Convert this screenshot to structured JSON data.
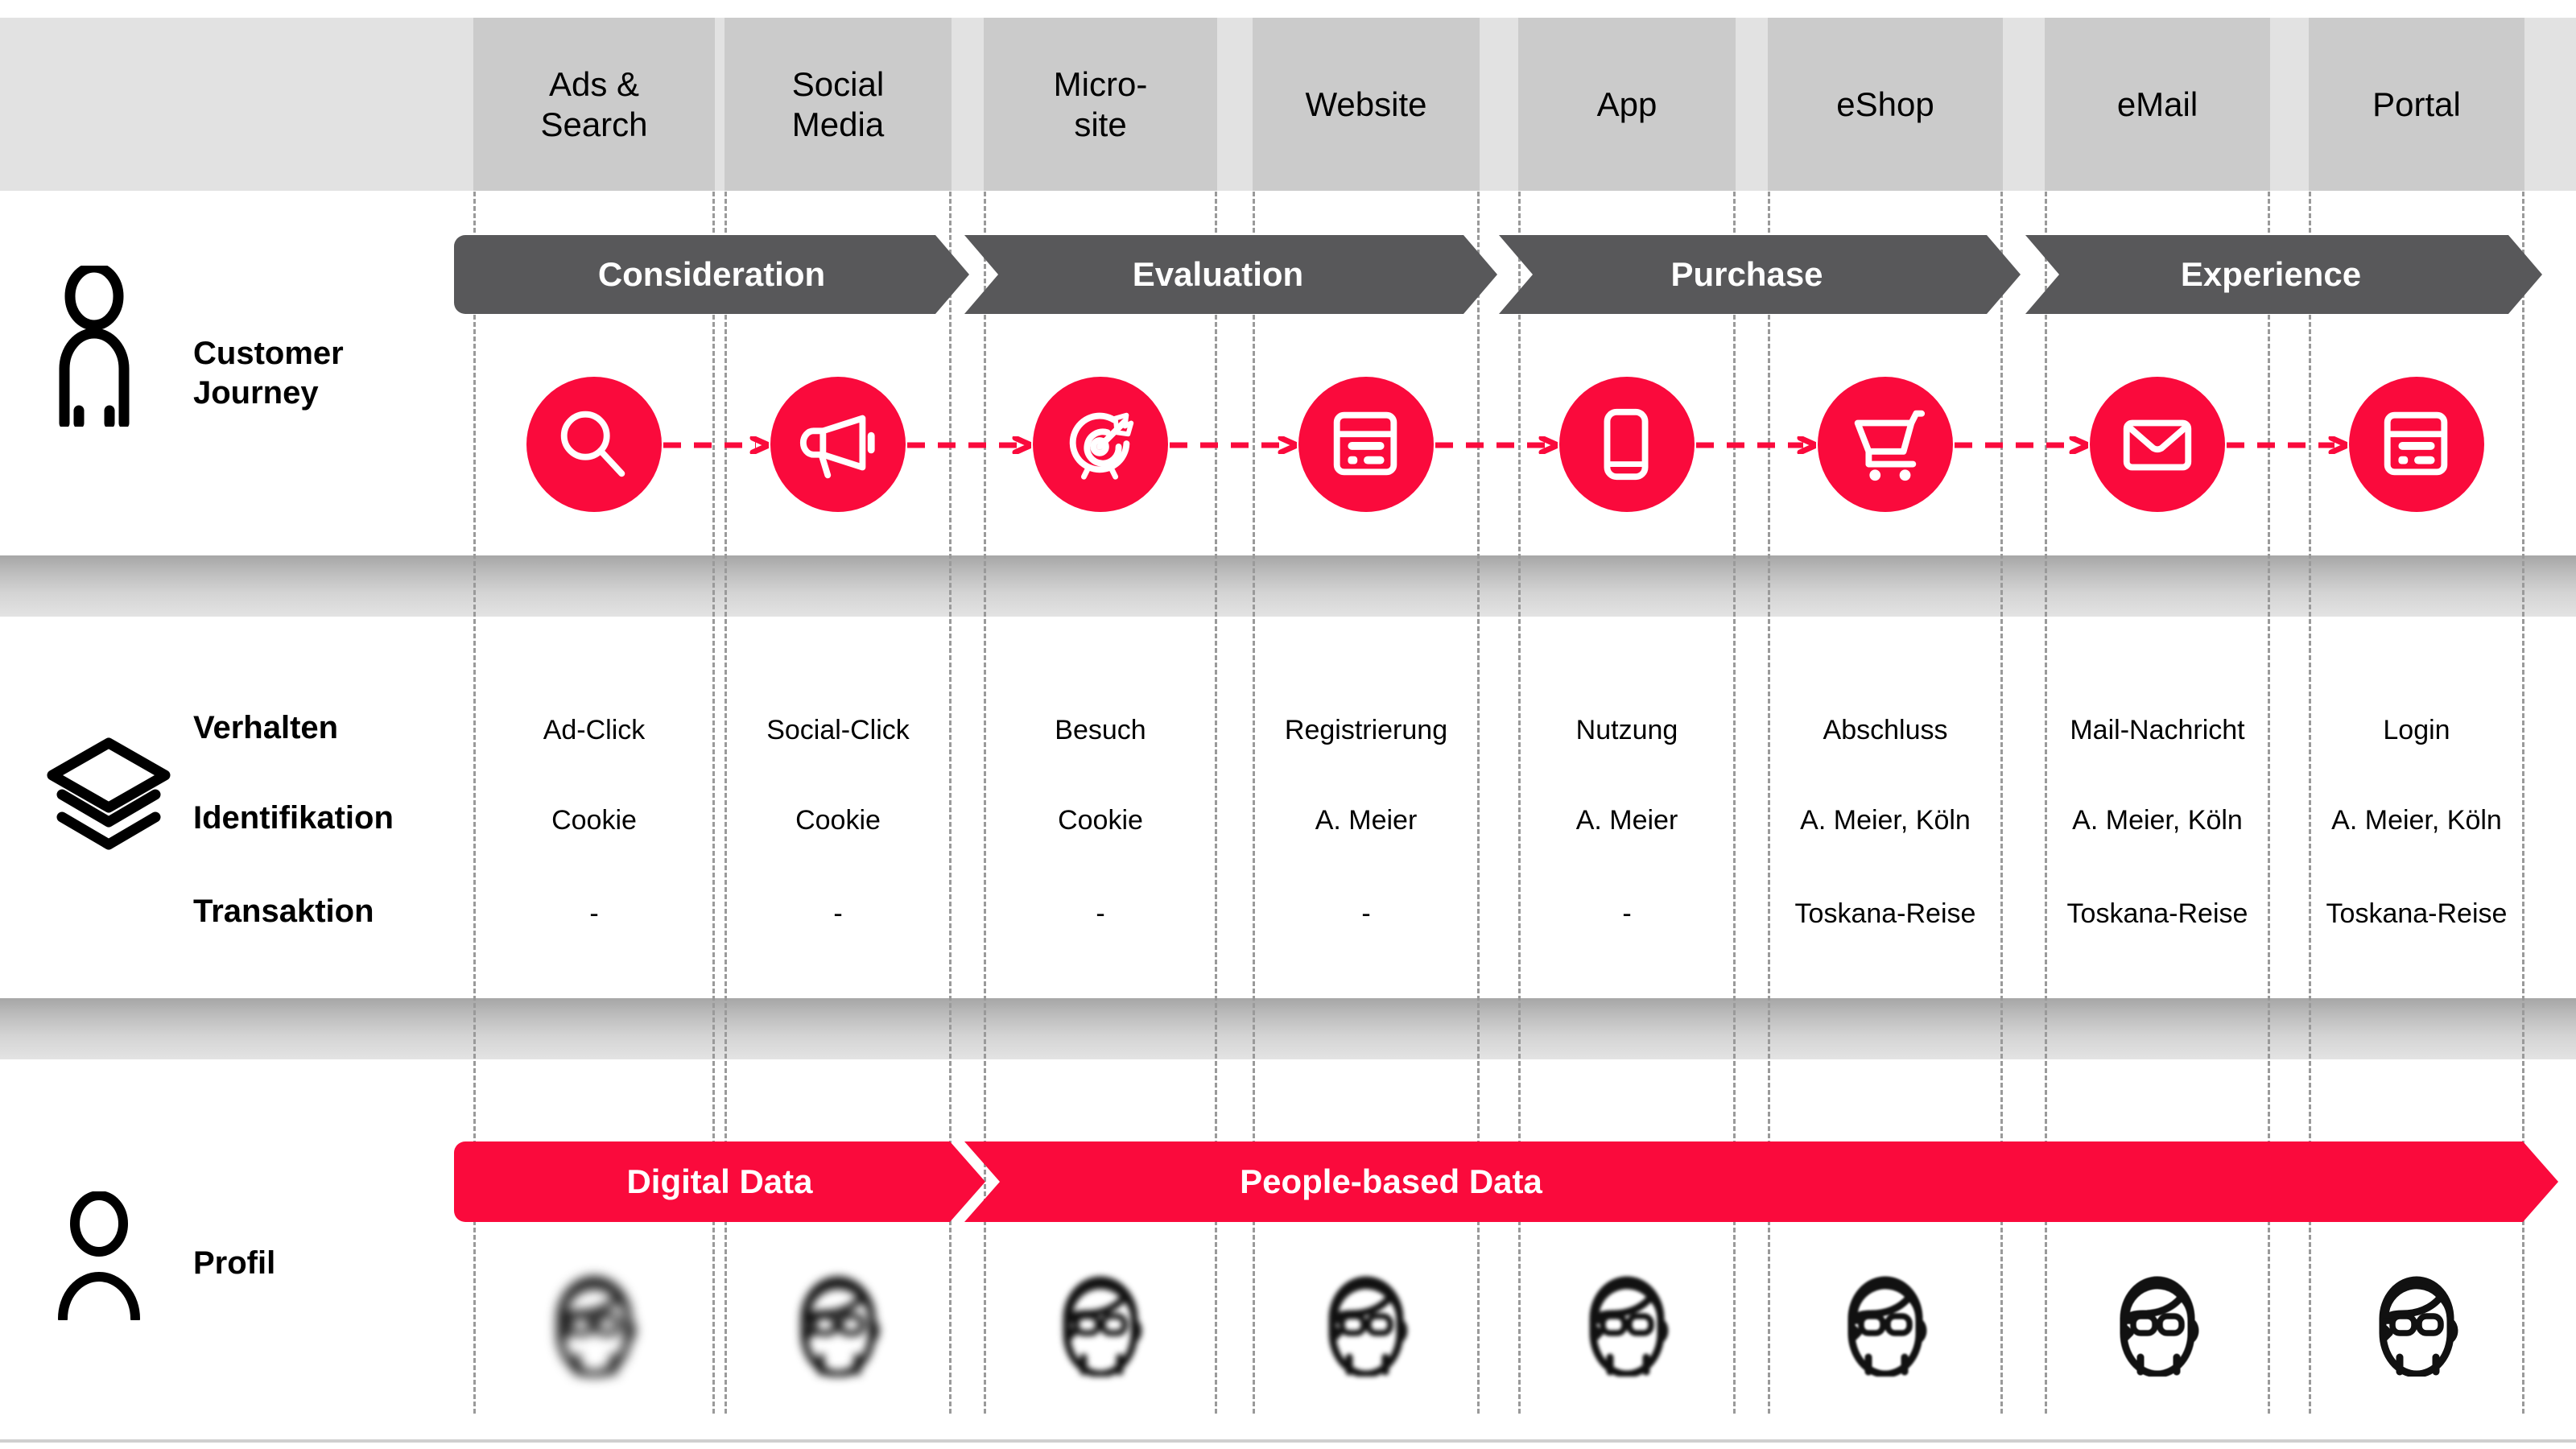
{
  "colors": {
    "accent_red": "#fa0a3c",
    "stage_dark": "#58585a",
    "header_band": "#e2e2e2",
    "channel_box": "#cbcbcb",
    "dashed_lane": "#9a9a9a"
  },
  "channels": [
    {
      "label": "Ads & Search",
      "line1": "Ads &",
      "line2": "Search"
    },
    {
      "label": "Social Media",
      "line1": "Social",
      "line2": "Media"
    },
    {
      "label": "Micro-site",
      "line1": "Micro-",
      "line2": "site"
    },
    {
      "label": "Website",
      "line1": "Website",
      "line2": ""
    },
    {
      "label": "App",
      "line1": "App",
      "line2": ""
    },
    {
      "label": "eShop",
      "line1": "eShop",
      "line2": ""
    },
    {
      "label": "eMail",
      "line1": "eMail",
      "line2": ""
    },
    {
      "label": "Portal",
      "line1": "Portal",
      "line2": ""
    }
  ],
  "rows": {
    "journey": {
      "label_line1": "Customer",
      "label_line2": "Journey",
      "icon": "person-standing-icon"
    },
    "data": {
      "icon": "layers-stack-icon"
    },
    "profile": {
      "label": "Profil",
      "icon": "person-bust-icon"
    }
  },
  "journey_stages": [
    {
      "label": "Consideration"
    },
    {
      "label": "Evaluation"
    },
    {
      "label": "Purchase"
    },
    {
      "label": "Experience"
    }
  ],
  "journey_touchpoints": [
    {
      "channel": "Ads & Search",
      "icon": "magnifier-search-icon"
    },
    {
      "channel": "Social Media",
      "icon": "megaphone-icon"
    },
    {
      "channel": "Micro-site",
      "icon": "target-dartboard-icon"
    },
    {
      "channel": "Website",
      "icon": "webpage-browser-icon"
    },
    {
      "channel": "App",
      "icon": "mobile-phone-icon"
    },
    {
      "channel": "eShop",
      "icon": "shopping-cart-icon"
    },
    {
      "channel": "eMail",
      "icon": "envelope-mail-icon"
    },
    {
      "channel": "Portal",
      "icon": "webpage-browser-icon"
    }
  ],
  "data_table": {
    "row_headers": [
      "Verhalten",
      "Identifikation",
      "Transaktion"
    ],
    "columns": [
      "Ads & Search",
      "Social Media",
      "Micro-site",
      "Website",
      "App",
      "eShop",
      "eMail",
      "Portal"
    ],
    "values": [
      [
        "Ad-Click",
        "Social-Click",
        "Besuch",
        "Registrierung",
        "Nutzung",
        "Abschluss",
        "Mail-Nachricht",
        "Login"
      ],
      [
        "Cookie",
        "Cookie",
        "Cookie",
        "A. Meier",
        "A. Meier",
        "A. Meier, Köln",
        "A. Meier, Köln",
        "A. Meier, Köln"
      ],
      [
        "-",
        "-",
        "-",
        "-",
        "-",
        "Toskana-Reise",
        "Toskana-Reise",
        "Toskana-Reise"
      ]
    ]
  },
  "profile_bands": [
    {
      "label": "Digital Data"
    },
    {
      "label": "People-based Data"
    }
  ],
  "profile_faces": [
    {
      "channel": "Ads & Search",
      "blur": 7
    },
    {
      "channel": "Social Media",
      "blur": 5.2
    },
    {
      "channel": "Micro-site",
      "blur": 3.8
    },
    {
      "channel": "Website",
      "blur": 2.8
    },
    {
      "channel": "App",
      "blur": 2.0
    },
    {
      "channel": "eShop",
      "blur": 1.3
    },
    {
      "channel": "eMail",
      "blur": 0.6
    },
    {
      "channel": "Portal",
      "blur": 0
    }
  ]
}
